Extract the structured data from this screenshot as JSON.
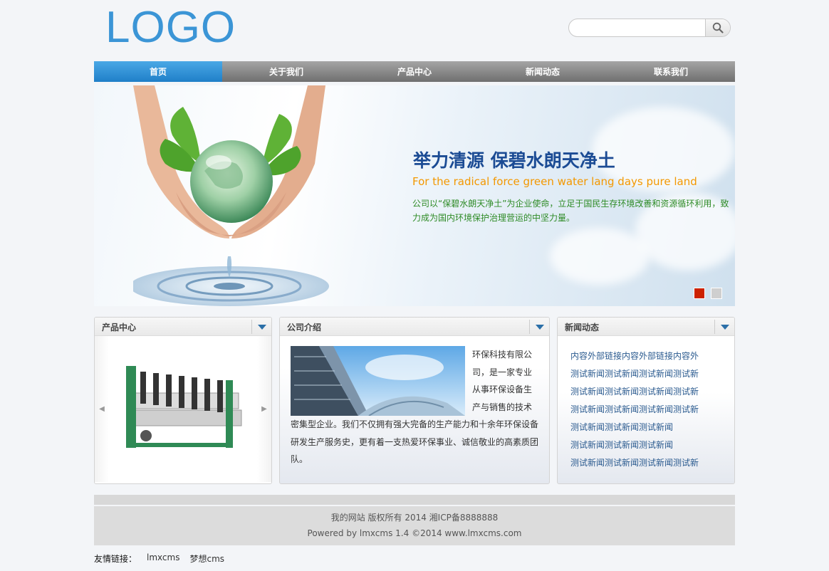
{
  "header": {
    "logo_text": "LOGO",
    "search": {
      "placeholder": "",
      "value": ""
    }
  },
  "nav": {
    "items": [
      {
        "label": "首页",
        "active": true
      },
      {
        "label": "关于我们"
      },
      {
        "label": "产品中心"
      },
      {
        "label": "新闻动态"
      },
      {
        "label": "联系我们"
      }
    ]
  },
  "banner": {
    "title": "举力清源 保碧水朗天净土",
    "subtitle": "For the radical force green water lang days pure land",
    "description": "公司以“保碧水朗天净土”为企业使命，立足于国民生存环境改善和资源循环利用，致力成为国内环境保护治理营运的中坚力量。",
    "slides": 2,
    "active_slide": 1
  },
  "products": {
    "title": "产品中心"
  },
  "about": {
    "title": "公司介绍",
    "text": "环保科技有限公司，是一家专业从事环保设备生产与销售的技术密集型企业。我们不仅拥有强大完备的生产能力和十余年环保设备研发生产服务史，更有着一支热爱环保事业、诚信敬业的高素质团队。"
  },
  "news": {
    "title": "新闻动态",
    "items": [
      "内容外部链接内容外部链接内容外",
      "测试新闻测试新闻测试新闻测试新",
      "测试新闻测试新闻测试新闻测试新",
      "测试新闻测试新闻测试新闻测试新",
      "测试新闻测试新闻测试新闻",
      "测试新闻测试新闻测试新闻",
      "测试新闻测试新闻测试新闻测试新"
    ]
  },
  "footer": {
    "copyright": "我的网站 版权所有 2014 湘ICP备8888888",
    "powered": "Powered by lmxcms 1.4 ©2014 www.lmxcms.com"
  },
  "friend_links": {
    "label": "友情链接：",
    "items": [
      "lmxcms",
      "梦想cms"
    ]
  },
  "colors": {
    "accent": "#2a8ad8",
    "brand_logo": "#3b95d6",
    "title_blue": "#1b4b94",
    "subtitle_orange": "#f39800",
    "desc_green": "#2e8b26",
    "active_dot": "#cc2200"
  }
}
